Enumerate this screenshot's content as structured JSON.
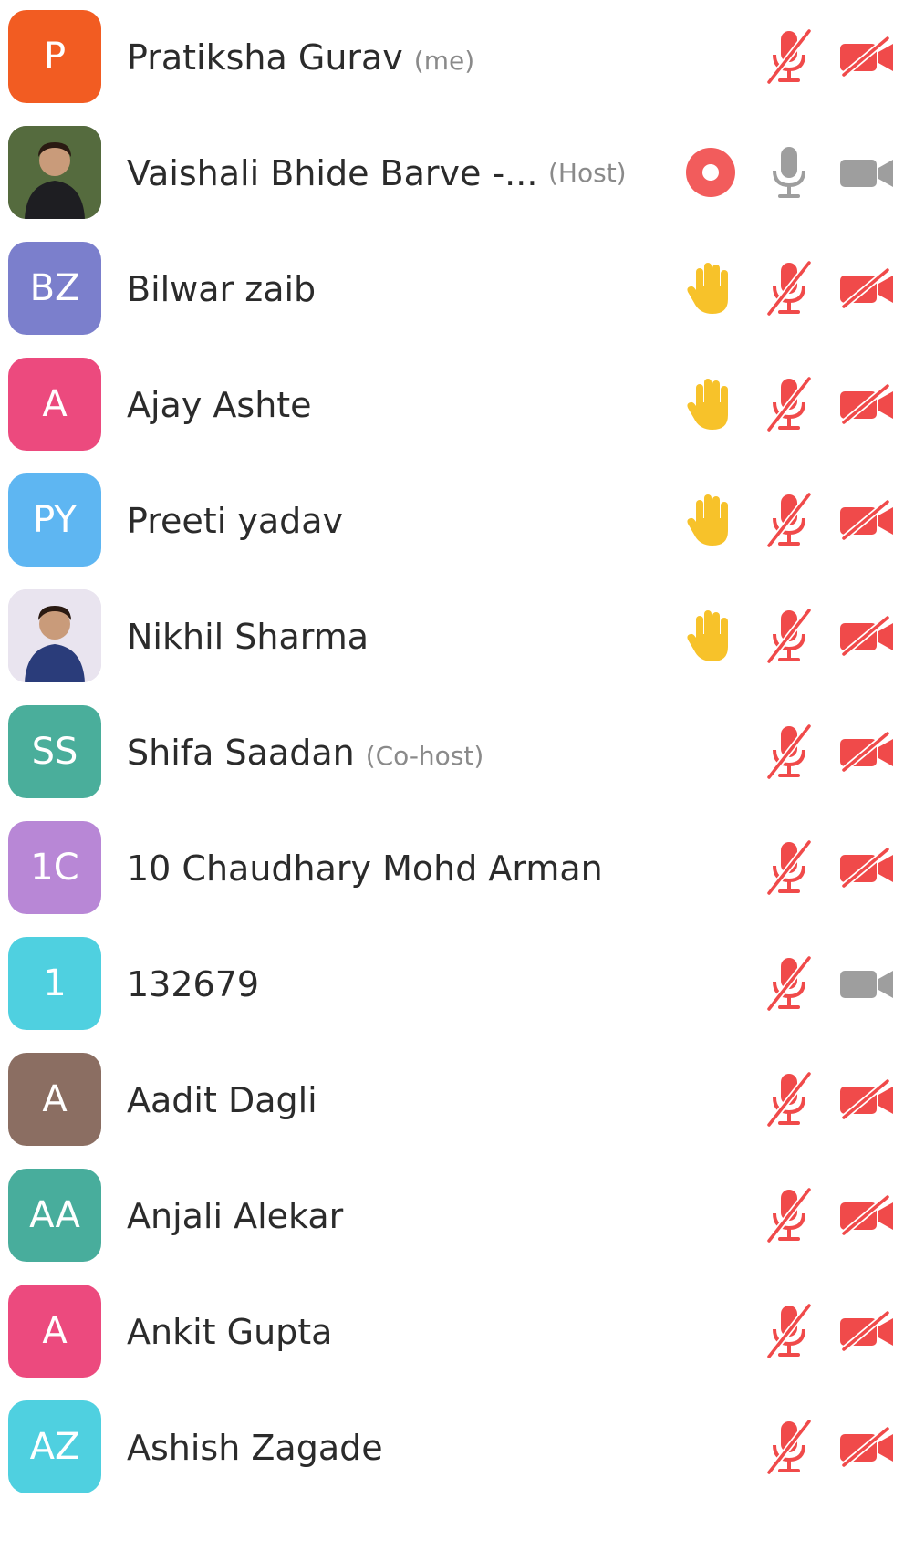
{
  "participants": [
    {
      "initials": "P",
      "name": "Pratiksha Gurav",
      "tag": "(me)",
      "avatar_color": "#f25c22",
      "photo": false,
      "hand": false,
      "recording": false,
      "mic": "muted",
      "cam": "off"
    },
    {
      "initials": "",
      "name": "Vaishali Bhide Barve -...",
      "tag": "(Host)",
      "avatar_color": "#3a4a2e",
      "photo": true,
      "hand": false,
      "recording": true,
      "mic": "on",
      "cam": "on"
    },
    {
      "initials": "BZ",
      "name": "Bilwar zaib",
      "tag": "",
      "avatar_color": "#7b7fcc",
      "photo": false,
      "hand": true,
      "recording": false,
      "mic": "muted",
      "cam": "off"
    },
    {
      "initials": "A",
      "name": "Ajay Ashte",
      "tag": "",
      "avatar_color": "#ec4a7e",
      "photo": false,
      "hand": true,
      "recording": false,
      "mic": "muted",
      "cam": "off"
    },
    {
      "initials": "PY",
      "name": "Preeti yadav",
      "tag": "",
      "avatar_color": "#5eb6f2",
      "photo": false,
      "hand": true,
      "recording": false,
      "mic": "muted",
      "cam": "off"
    },
    {
      "initials": "",
      "name": "Nikhil Sharma",
      "tag": "",
      "avatar_color": "#dcd4e6",
      "photo": true,
      "hand": true,
      "recording": false,
      "mic": "muted",
      "cam": "off"
    },
    {
      "initials": "SS",
      "name": "Shifa Saadan",
      "tag": "(Co-host)",
      "avatar_color": "#4aae9b",
      "photo": false,
      "hand": false,
      "recording": false,
      "mic": "muted",
      "cam": "off"
    },
    {
      "initials": "1C",
      "name": "10 Chaudhary Mohd Arman",
      "tag": "",
      "avatar_color": "#b887d6",
      "photo": false,
      "hand": false,
      "recording": false,
      "mic": "muted",
      "cam": "off"
    },
    {
      "initials": "1",
      "name": "132679",
      "tag": "",
      "avatar_color": "#4fd0e0",
      "photo": false,
      "hand": false,
      "recording": false,
      "mic": "muted",
      "cam": "on"
    },
    {
      "initials": "A",
      "name": "Aadit Dagli",
      "tag": "",
      "avatar_color": "#8b6e62",
      "photo": false,
      "hand": false,
      "recording": false,
      "mic": "muted",
      "cam": "off"
    },
    {
      "initials": "AA",
      "name": "Anjali Alekar",
      "tag": "",
      "avatar_color": "#48ad9c",
      "photo": false,
      "hand": false,
      "recording": false,
      "mic": "muted",
      "cam": "off"
    },
    {
      "initials": "A",
      "name": "Ankit Gupta",
      "tag": "",
      "avatar_color": "#ec4a7e",
      "photo": false,
      "hand": false,
      "recording": false,
      "mic": "muted",
      "cam": "off"
    },
    {
      "initials": "AZ",
      "name": "Ashish Zagade",
      "tag": "",
      "avatar_color": "#4fd0e0",
      "photo": false,
      "hand": false,
      "recording": false,
      "mic": "muted",
      "cam": "off"
    }
  ],
  "colors": {
    "muted_red": "#f04a4a",
    "active_gray": "#9e9e9e",
    "record_red": "#f25c5c",
    "hand_yellow": "#f7c22a"
  }
}
